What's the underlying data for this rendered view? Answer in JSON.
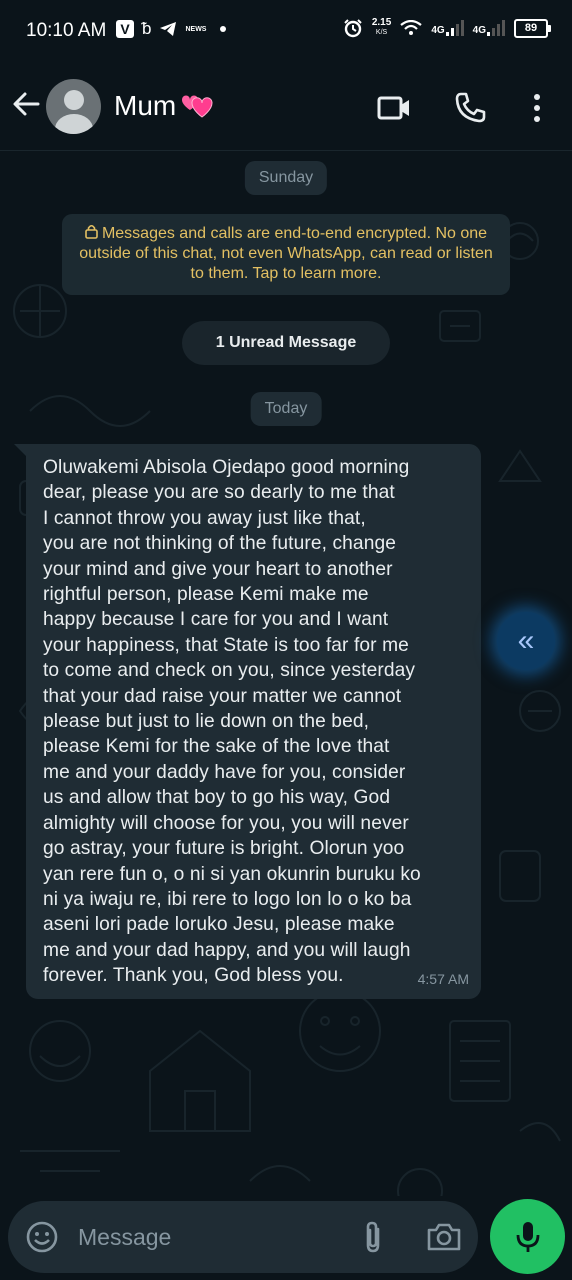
{
  "status_bar": {
    "time": "10:10 AM",
    "app_icon_letter": "V",
    "news_label": "NEWS",
    "speed_value": "2.15",
    "speed_unit": "K/S",
    "network_1": "4G",
    "network_2": "4G",
    "battery": "89"
  },
  "header": {
    "contact_name": "Mum",
    "icons": [
      "back-arrow-icon",
      "avatar",
      "video-call-icon",
      "voice-call-icon",
      "more-icon"
    ]
  },
  "chat": {
    "day_label_1": "Sunday",
    "encryption_notice": "Messages and calls are end-to-end encrypted. No one outside of this chat, not even WhatsApp, can read or listen to them. Tap to learn more.",
    "unread_label": "1 Unread Message",
    "day_label_2": "Today",
    "message": {
      "text": "Oluwakemi Abisola Ojedapo good morning\ndear, please you are so dearly to me that\nI cannot throw you away just like that,\nyou are not thinking of the future, change\nyour mind and give your heart to another\nrightful person, please Kemi make me\nhappy because I care for you and I want\nyour happiness, that State is too far for me\nto come and check on you, since yesterday\nthat your dad raise your matter we cannot\nplease but just to lie down on the bed,\nplease Kemi for the sake of the love that\nme and your daddy have for you, consider\nus and allow that boy to go his way, God\nalmighty will choose for you, you will never\ngo astray, your future is bright.  Olorun yoo\nyan rere fun o, o ni si yan okunrin buruku ko\nni ya iwaju re,  ibi rere to logo lon lo o ko ba\naseni lori pade loruko Jesu, please make\nme and your dad happy, and you will laugh\nforever. Thank you, God bless you.",
      "time": "4:57 AM"
    },
    "forward_button_glyph": "«"
  },
  "input": {
    "placeholder": "Message"
  },
  "colors": {
    "background": "#0b141a",
    "bubble": "#1f2c34",
    "encryption_text": "#e3c063",
    "mic_button": "#21c063",
    "secondary_text": "#8696a0"
  }
}
